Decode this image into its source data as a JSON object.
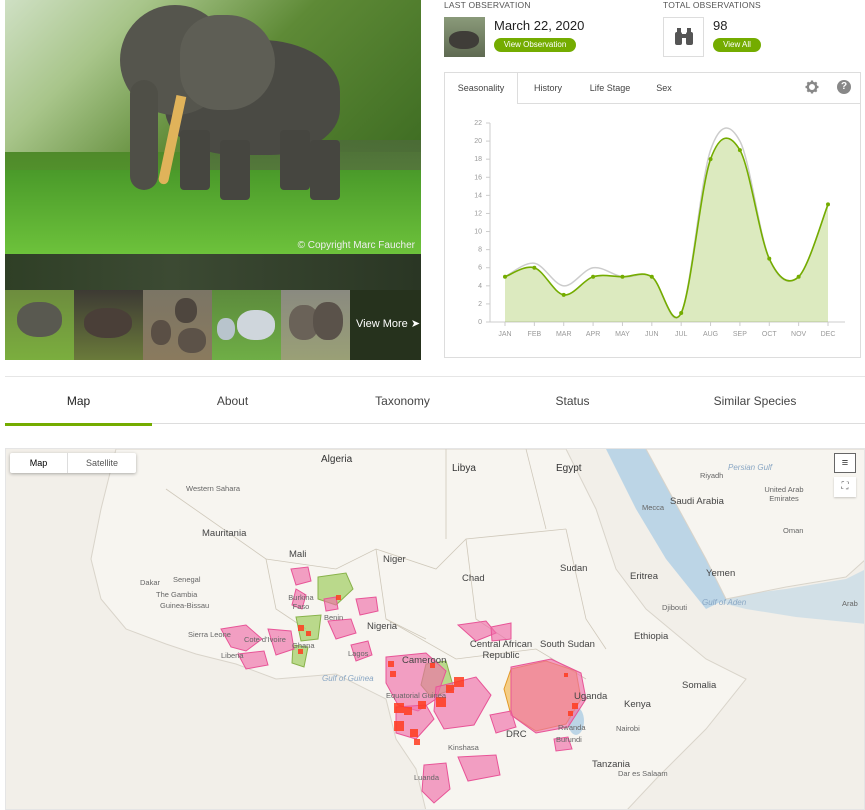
{
  "hero": {
    "copyright": "© Copyright Marc Faucher",
    "view_more": "View More"
  },
  "last_observation": {
    "caption": "LAST OBSERVATION",
    "date": "March 22, 2020",
    "button": "View Observation"
  },
  "total_observations": {
    "caption": "TOTAL OBSERVATIONS",
    "count": "98",
    "button": "View All"
  },
  "chart_tabs": [
    "Seasonality",
    "History",
    "Life Stage",
    "Sex"
  ],
  "chart_data": {
    "type": "area",
    "categories": [
      "JAN",
      "FEB",
      "MAR",
      "APR",
      "MAY",
      "JUN",
      "JUL",
      "AUG",
      "SEP",
      "OCT",
      "NOV",
      "DEC"
    ],
    "series": [
      {
        "values": [
          5,
          6,
          3,
          5,
          5,
          5,
          1,
          18,
          19,
          7,
          5,
          13
        ],
        "color": "#74ac00"
      },
      {
        "values": [
          5,
          6.5,
          4,
          6,
          5,
          5,
          1,
          19,
          20,
          7,
          5,
          13
        ],
        "color": "#cccccc"
      }
    ],
    "yticks": [
      "0",
      "2",
      "4",
      "6",
      "8",
      "10",
      "12",
      "14",
      "16",
      "18",
      "20",
      "22"
    ],
    "ylim": [
      0,
      22
    ]
  },
  "nav": {
    "items": [
      "Map",
      "About",
      "Taxonomy",
      "Status",
      "Similar Species"
    ]
  },
  "map": {
    "toggle": [
      "Map",
      "Satellite"
    ],
    "labels": [
      "Algeria",
      "Libya",
      "Egypt",
      "Western Sahara",
      "Mauritania",
      "Mali",
      "Niger",
      "Chad",
      "Sudan",
      "Eritrea",
      "Yemen",
      "Saudi Arabia",
      "Oman",
      "United Arab Emirates",
      "Riyadh",
      "Mecca",
      "Djibouti",
      "Senegal",
      "Dakar",
      "The Gambia",
      "Guinea-Bissau",
      "Sierra Leone",
      "Liberia",
      "Cote d'Ivoire",
      "Burkina Faso",
      "Ghana",
      "Benin",
      "Nigeria",
      "Lagos",
      "Cameroon",
      "Central African Republic",
      "South Sudan",
      "Ethiopia",
      "Somalia",
      "Uganda",
      "Kenya",
      "Nairobi",
      "Rwanda",
      "Burundi",
      "DRC",
      "Kinshasa",
      "Luanda",
      "Tanzania",
      "Dar es Salaam",
      "Gulf of Guinea",
      "Gulf of Aden",
      "Persian Gulf",
      "Ghana",
      "Equatorial Guinea",
      "Arab"
    ]
  },
  "colors": {
    "accent": "#74ac00",
    "range_pink": "#f06ea9",
    "range_green": "#a6cf6a",
    "range_orange": "#f2b33d",
    "obs_red": "#ff3b1f"
  }
}
